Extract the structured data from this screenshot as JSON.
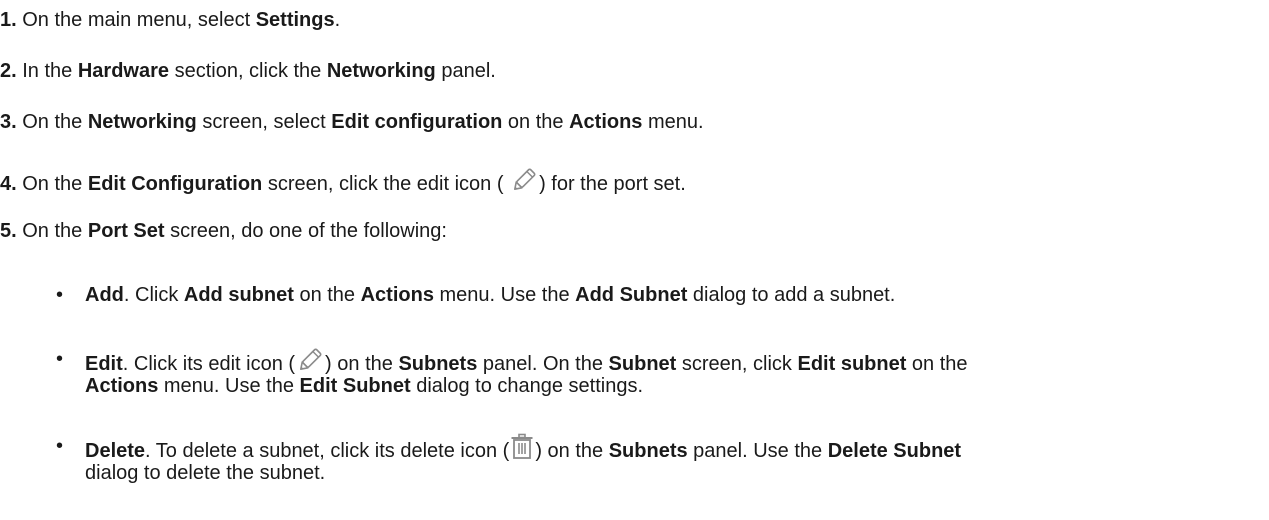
{
  "steps": [
    {
      "num": "1.",
      "t1": "On the main menu, select ",
      "b1": "Settings",
      "t2": "."
    },
    {
      "num": "2.",
      "t1": "In the ",
      "b1": "Hardware",
      "t2": " section, click the ",
      "b2": "Networking",
      "t3": " panel."
    },
    {
      "num": "3.",
      "t1": "On the ",
      "b1": "Networking",
      "t2": " screen, select ",
      "b2": "Edit configuration",
      "t3": " on the ",
      "b3": "Actions",
      "t4": " menu."
    },
    {
      "num": "4.",
      "t1": "On the ",
      "b1": "Edit Configuration",
      "t2": " screen, click the edit icon ( ",
      "t3": ") for the port set."
    },
    {
      "num": "5.",
      "t1": "On the ",
      "b1": "Port Set",
      "t2": " screen, do one of the following:"
    }
  ],
  "options": [
    {
      "bullet": "•",
      "b1": "Add",
      "t1": ". Click ",
      "b2": "Add subnet",
      "t2": " on the ",
      "b3": "Actions",
      "t3": " menu. Use the ",
      "b4": "Add Subnet",
      "t4": " dialog to add a subnet."
    },
    {
      "bullet": "•",
      "b1": "Edit",
      "t1": ". Click its edit icon (",
      "t2": ") on the ",
      "b2": "Subnets",
      "t3": " panel. On the ",
      "b3": "Subnet",
      "t4": " screen, click ",
      "b4": "Edit subnet",
      "t5": " on the",
      "line2_b1": "Actions",
      "line2_t1": " menu. Use the ",
      "line2_b2": "Edit Subnet",
      "line2_t2": " dialog to change settings."
    },
    {
      "bullet": "•",
      "b1": "Delete",
      "t1": ". To delete a subnet, click its delete icon (",
      "t2": ") on the ",
      "b2": "Subnets",
      "t3": " panel. Use the ",
      "b3": "Delete Subnet",
      "line2_t1": "dialog to delete the subnet."
    }
  ],
  "icons": {
    "edit": "pencil-icon",
    "delete": "trash-icon"
  }
}
